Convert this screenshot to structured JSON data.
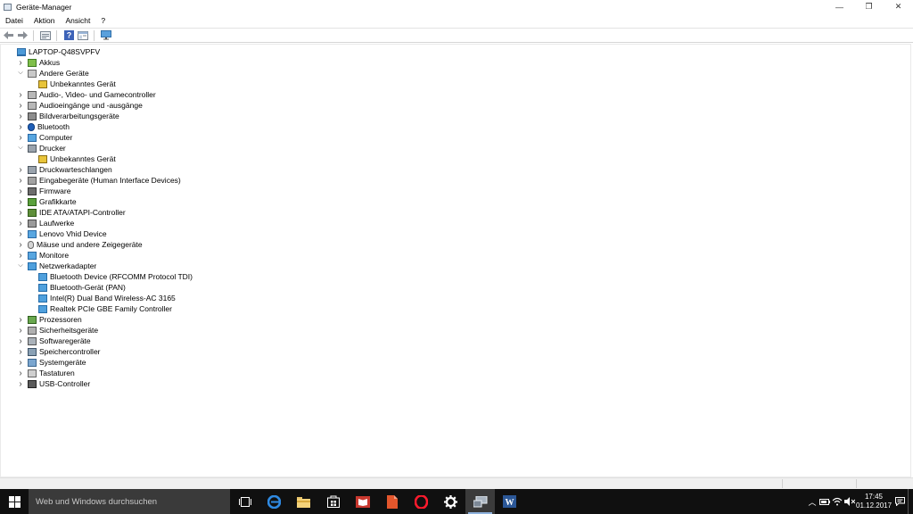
{
  "window": {
    "title": "Geräte-Manager",
    "controls": {
      "minimize": "—",
      "maximize": "❐",
      "close": "✕"
    }
  },
  "menu": [
    "Datei",
    "Aktion",
    "Ansicht",
    "?"
  ],
  "toolbar": {
    "buttons": [
      "back-icon",
      "forward-icon",
      "properties-icon",
      "help-icon",
      "show-hide-icon",
      "monitor-icon"
    ]
  },
  "tree": {
    "root": "LAPTOP-Q48SVPFV",
    "nodes": [
      {
        "label": "Akkus",
        "level": 1,
        "state": "collapsed",
        "icon": "battery-icon"
      },
      {
        "label": "Andere Geräte",
        "level": 1,
        "state": "expanded",
        "icon": "unknown-device-icon"
      },
      {
        "label": "Unbekanntes Gerät",
        "level": 2,
        "state": "leaf",
        "icon": "warning-device-icon"
      },
      {
        "label": "Audio-, Video- und Gamecontroller",
        "level": 1,
        "state": "collapsed",
        "icon": "speaker-icon"
      },
      {
        "label": "Audioeingänge und -ausgänge",
        "level": 1,
        "state": "collapsed",
        "icon": "speaker-icon"
      },
      {
        "label": "Bildverarbeitungsgeräte",
        "level": 1,
        "state": "collapsed",
        "icon": "camera-icon"
      },
      {
        "label": "Bluetooth",
        "level": 1,
        "state": "collapsed",
        "icon": "bluetooth-icon"
      },
      {
        "label": "Computer",
        "level": 1,
        "state": "collapsed",
        "icon": "monitor-icon"
      },
      {
        "label": "Drucker",
        "level": 1,
        "state": "expanded",
        "icon": "printer-icon"
      },
      {
        "label": "Unbekanntes Gerät",
        "level": 2,
        "state": "leaf",
        "icon": "warning-device-icon"
      },
      {
        "label": "Druckwarteschlangen",
        "level": 1,
        "state": "collapsed",
        "icon": "printer-icon"
      },
      {
        "label": "Eingabegeräte (Human Interface Devices)",
        "level": 1,
        "state": "collapsed",
        "icon": "hid-icon"
      },
      {
        "label": "Firmware",
        "level": 1,
        "state": "collapsed",
        "icon": "chip-icon"
      },
      {
        "label": "Grafikkarte",
        "level": 1,
        "state": "collapsed",
        "icon": "display-adapter-icon"
      },
      {
        "label": "IDE ATA/ATAPI-Controller",
        "level": 1,
        "state": "collapsed",
        "icon": "controller-icon"
      },
      {
        "label": "Laufwerke",
        "level": 1,
        "state": "collapsed",
        "icon": "drive-icon"
      },
      {
        "label": "Lenovo Vhid Device",
        "level": 1,
        "state": "collapsed",
        "icon": "monitor-icon"
      },
      {
        "label": "Mäuse und andere Zeigegeräte",
        "level": 1,
        "state": "collapsed",
        "icon": "mouse-icon"
      },
      {
        "label": "Monitore",
        "level": 1,
        "state": "collapsed",
        "icon": "monitor-icon"
      },
      {
        "label": "Netzwerkadapter",
        "level": 1,
        "state": "expanded",
        "icon": "network-icon"
      },
      {
        "label": "Bluetooth Device (RFCOMM Protocol TDI)",
        "level": 2,
        "state": "leaf",
        "icon": "network-icon"
      },
      {
        "label": "Bluetooth-Gerät (PAN)",
        "level": 2,
        "state": "leaf",
        "icon": "network-icon"
      },
      {
        "label": "Intel(R) Dual Band Wireless-AC 3165",
        "level": 2,
        "state": "leaf",
        "icon": "network-icon"
      },
      {
        "label": "Realtek PCIe GBE Family Controller",
        "level": 2,
        "state": "leaf",
        "icon": "network-icon"
      },
      {
        "label": "Prozessoren",
        "level": 1,
        "state": "collapsed",
        "icon": "cpu-icon"
      },
      {
        "label": "Sicherheitsgeräte",
        "level": 1,
        "state": "collapsed",
        "icon": "security-icon"
      },
      {
        "label": "Softwaregeräte",
        "level": 1,
        "state": "collapsed",
        "icon": "software-device-icon"
      },
      {
        "label": "Speichercontroller",
        "level": 1,
        "state": "collapsed",
        "icon": "storage-controller-icon"
      },
      {
        "label": "Systemgeräte",
        "level": 1,
        "state": "collapsed",
        "icon": "system-device-icon"
      },
      {
        "label": "Tastaturen",
        "level": 1,
        "state": "collapsed",
        "icon": "keyboard-icon"
      },
      {
        "label": "USB-Controller",
        "level": 1,
        "state": "collapsed",
        "icon": "usb-icon"
      }
    ]
  },
  "taskbar": {
    "search_placeholder": "Web und Windows durchsuchen",
    "apps": [
      "task-view-icon",
      "edge-icon",
      "file-explorer-icon",
      "store-icon",
      "reader-icon",
      "pdf-icon",
      "opera-icon",
      "settings-icon",
      "device-manager-icon",
      "word-icon"
    ],
    "active_app": "device-manager-icon",
    "tray": [
      "chevron-up-icon",
      "battery-icon",
      "wifi-icon",
      "volume-mute-icon"
    ],
    "time": "17:45",
    "date": "01.12.2017"
  }
}
